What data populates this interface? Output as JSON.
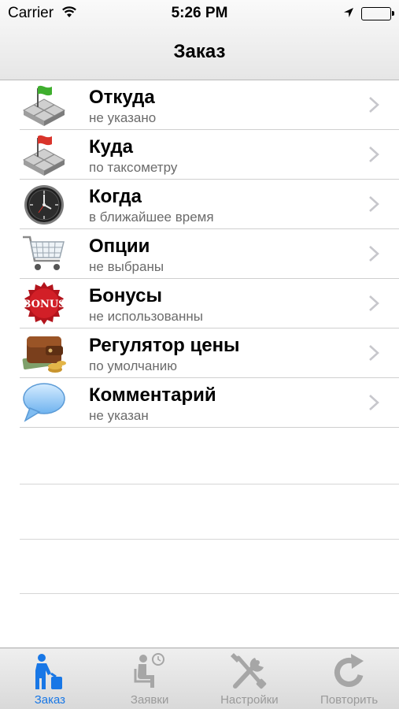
{
  "status_bar": {
    "carrier": "Carrier",
    "time": "5:26 PM",
    "battery_level": 1.0
  },
  "nav": {
    "title": "Заказ"
  },
  "rows": [
    {
      "title": "Откуда",
      "subtitle": "не указано",
      "icon": "green-flag-grid-icon"
    },
    {
      "title": "Куда",
      "subtitle": "по таксометру",
      "icon": "red-flag-grid-icon"
    },
    {
      "title": "Когда",
      "subtitle": "в ближайшее время",
      "icon": "clock-icon"
    },
    {
      "title": "Опции",
      "subtitle": "не выбраны",
      "icon": "shopping-cart-icon"
    },
    {
      "title": "Бонусы",
      "subtitle": "не использованны",
      "icon": "bonus-badge-icon",
      "badge_text": "BONUS"
    },
    {
      "title": "Регулятор цены",
      "subtitle": "по умолчанию",
      "icon": "wallet-icon"
    },
    {
      "title": "Комментарий",
      "subtitle": "не указан",
      "icon": "speech-bubble-icon"
    }
  ],
  "tabs": [
    {
      "label": "Заказ",
      "icon": "person-luggage-icon",
      "active": true
    },
    {
      "label": "Заявки",
      "icon": "seated-person-clock-icon",
      "active": false
    },
    {
      "label": "Настройки",
      "icon": "wrench-screwdriver-icon",
      "active": false
    },
    {
      "label": "Повторить",
      "icon": "refresh-icon",
      "active": false
    }
  ],
  "colors": {
    "accent": "#1877e6",
    "tab_inactive": "#9a9a9a",
    "subtitle": "#6b6b6b"
  }
}
